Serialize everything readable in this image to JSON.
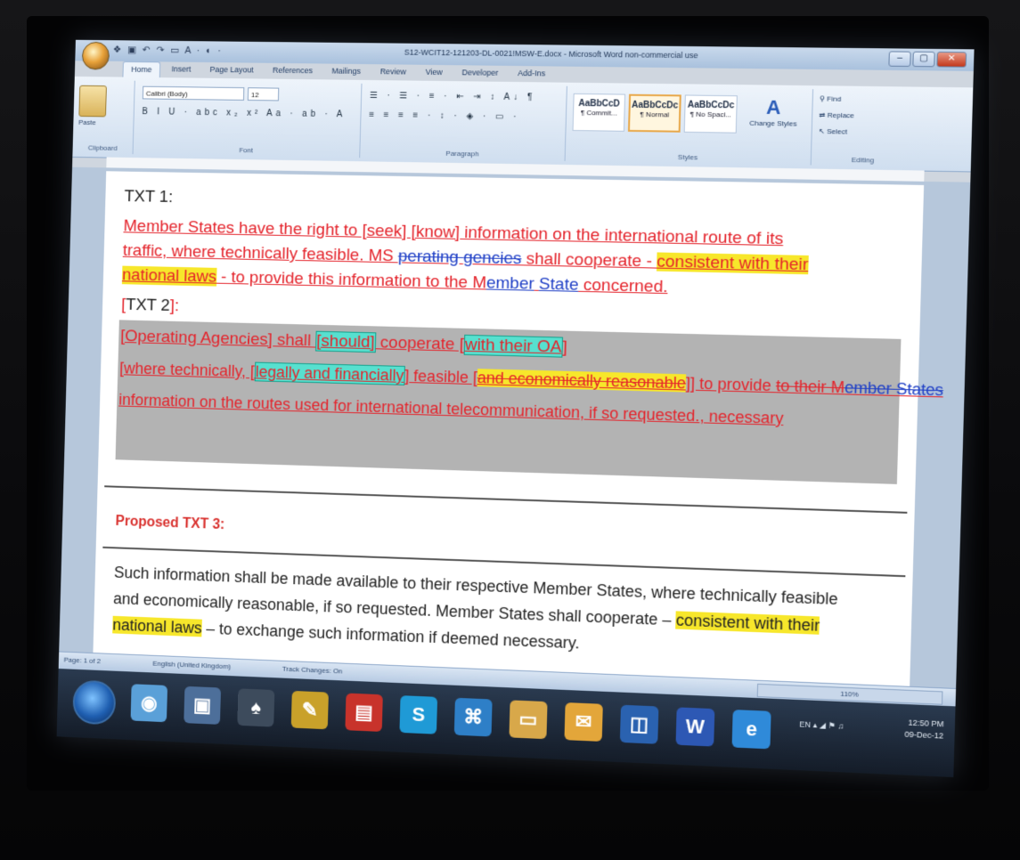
{
  "titlebar": {
    "quick_access": "❖ ▣ ↶ ↷ ▭ A · ◐ ·",
    "document_title": "S12-WCIT12-121203-DL-0021!MSW-E.docx - Microsoft Word non-commercial use",
    "minimize": "–",
    "maximize": "▢",
    "close": "✕"
  },
  "ribbon": {
    "tabs": [
      "Home",
      "Insert",
      "Page Layout",
      "References",
      "Mailings",
      "Review",
      "View",
      "Developer",
      "Add-Ins"
    ],
    "clipboard": {
      "paste_label": "Paste",
      "group_label": "Clipboard"
    },
    "font": {
      "font_name": "Calibri (Body)",
      "font_size": "12",
      "row2": "B I U · abc x₂ x² Aa · ab · A",
      "group_label": "Font"
    },
    "paragraph": {
      "row1": "☰ · ☰ · ≡ · ⇤ ⇥ ↕ A↓ ¶",
      "row2": "≡ ≡ ≡ ≡ · ↕ · ◈ · ▭ ·",
      "group_label": "Paragraph"
    },
    "styles": {
      "items": [
        {
          "preview": "AaBbCcD",
          "name": "¶ Commit..."
        },
        {
          "preview": "AaBbCcDc",
          "name": "¶ Normal"
        },
        {
          "preview": "AaBbCcDc",
          "name": "¶ No Spaci..."
        }
      ],
      "change_styles": "Change Styles",
      "group_label": "Styles"
    },
    "editing": {
      "find": "Find",
      "replace": "Replace",
      "select": "Select",
      "group_label": "Editing"
    }
  },
  "document": {
    "txt1_heading": "TXT 1:",
    "txt1_line1": "Member States have the right to [seek] [know] information on the international route of its",
    "txt1_line2": "traffic, where technically feasible. MS ",
    "txt1_line2_strike1": "perating ",
    "txt1_line2_strike2": "gencies",
    "txt1_line2_rest": " shall cooperate - ",
    "txt1_line2_hl": "consistent with their",
    "txt1_line3_hl": "national laws",
    "txt1_line3_a": " - to provide this information to the M",
    "txt1_line3_blue1": "ember",
    "txt1_line3_b": " ",
    "txt1_line3_blue2": "State",
    "txt1_line3_c": " concerned.",
    "txt2_open": "[",
    "txt2_heading": "TXT 2",
    "txt2_close": "]:",
    "txt2_line1_a": "[Operating Agencies] shall ",
    "txt2_line1_hl1": "[should]",
    "txt2_line1_b": " cooperate [",
    "txt2_line1_hl2": "with their OA",
    "txt2_line1_c": "]",
    "txt2_line2_a": "[where technically, [",
    "txt2_line2_hl": "legally and financially",
    "txt2_line2_b": "] feasible [",
    "txt2_line2_hlstrike": "and economically reasonable",
    "txt2_line2_c": "]] to provide ",
    "txt2_line2_strike": "to their M",
    "txt2_line2_bluestrike": "ember States",
    "txt2_line3_a": "information on the routes used for international telecommunication, if so requested.",
    "txt2_line3_b": ", necessary",
    "proposed_title": "Proposed TXT 3:",
    "txt3_line1": "Such information shall be made available to their respective Member States, where technically feasible",
    "txt3_line2_a": "and economically reasonable, if so requested. Member States shall cooperate – ",
    "txt3_line2_hl": "consistent with their",
    "txt3_line3_hl": "national laws",
    "txt3_line3_b": " – to exchange such information if deemed necessary."
  },
  "statusbar": {
    "page": "Page: 1 of 2",
    "language": "English (United Kingdom)",
    "track_changes": "Track Changes: On",
    "zoom": "110%"
  },
  "taskbar": {
    "apps": [
      {
        "icon": "chrome-icon",
        "glyph": "◉",
        "color": "#5aa0d8"
      },
      {
        "icon": "window-icon",
        "glyph": "▣",
        "color": "#4d6f9a"
      },
      {
        "icon": "app-icon",
        "glyph": "♠",
        "color": "#3d4b5c"
      },
      {
        "icon": "pen-icon",
        "glyph": "✎",
        "color": "#c9a12a"
      },
      {
        "icon": "pdf-icon",
        "glyph": "▤",
        "color": "#c8332b"
      },
      {
        "icon": "skype-icon",
        "glyph": "S",
        "color": "#1f9ad6"
      },
      {
        "icon": "network-icon",
        "glyph": "⌘",
        "color": "#2e7fc7"
      },
      {
        "icon": "folder-icon",
        "glyph": "▭",
        "color": "#d8a84a"
      },
      {
        "icon": "mail-icon",
        "glyph": "✉",
        "color": "#e3a63a"
      },
      {
        "icon": "outlook-icon",
        "glyph": "◫",
        "color": "#2a62b0"
      },
      {
        "icon": "word-icon",
        "glyph": "W",
        "color": "#2d58b4"
      },
      {
        "icon": "ie-icon",
        "glyph": "e",
        "color": "#2f8ad9"
      }
    ],
    "tray": "EN ▴ ◢ ⚑ ♫",
    "time": "12:50 PM",
    "date": "09-Dec-12"
  }
}
